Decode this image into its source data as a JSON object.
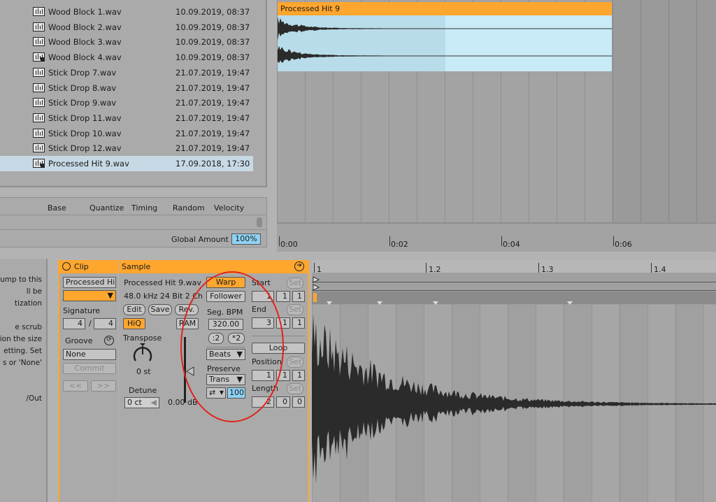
{
  "browser": {
    "files": [
      {
        "name": "Wood Block 1.wav",
        "date": "10.09.2019, 08:37",
        "locked": false
      },
      {
        "name": "Wood Block 2.wav",
        "date": "10.09.2019, 08:37",
        "locked": false
      },
      {
        "name": "Wood Block 3.wav",
        "date": "10.09.2019, 08:37",
        "locked": false
      },
      {
        "name": "Wood Block 4.wav",
        "date": "10.09.2019, 08:37",
        "locked": true
      },
      {
        "name": "Stick Drop 7.wav",
        "date": "21.07.2019, 19:47",
        "locked": false
      },
      {
        "name": "Stick Drop 8.wav",
        "date": "21.07.2019, 19:47",
        "locked": false
      },
      {
        "name": "Stick Drop 9.wav",
        "date": "21.07.2019, 19:47",
        "locked": false
      },
      {
        "name": "Stick Drop 11.wav",
        "date": "21.07.2019, 19:47",
        "locked": false
      },
      {
        "name": "Stick Drop 10.wav",
        "date": "21.07.2019, 19:47",
        "locked": false
      },
      {
        "name": "Stick Drop 12.wav",
        "date": "21.07.2019, 19:47",
        "locked": false
      },
      {
        "name": "Processed Hit 9.wav",
        "date": "17.09.2018, 17:30",
        "locked": true,
        "selected": true
      }
    ],
    "icon": "waveform-file-icon"
  },
  "groove_pool": {
    "headers": [
      "Base",
      "Quantize",
      "Timing",
      "Random",
      "Velocity"
    ],
    "global_amount_label": "Global Amount",
    "global_amount_value": "100%"
  },
  "arrangement": {
    "clip_name": "Processed Hit 9",
    "time_labels": [
      "0:00",
      "0:02",
      "0:04",
      "0:06"
    ]
  },
  "help": {
    "lines": [
      "ump to this",
      "ll be",
      "tization",
      "",
      "e scrub",
      "tion the size",
      "etting. Set",
      "s or 'None'",
      "",
      "",
      "/Out"
    ]
  },
  "clip_panel": {
    "title": "Clip",
    "name_value": "Processed Hi",
    "signature_label": "Signature",
    "sig_num": "4",
    "sig_sep": "/",
    "sig_den": "4",
    "groove_label": "Groove",
    "groove_value": "None",
    "commit_label": "Commit",
    "prev_label": "<<",
    "next_label": ">>"
  },
  "sample_panel": {
    "title": "Sample",
    "file_name": "Processed Hit 9.wav",
    "file_info": "48.0 kHz 24 Bit 2 Ch",
    "edit_label": "Edit",
    "save_label": "Save",
    "rev_label": "Rev.",
    "hiq_label": "HiQ",
    "ram_label": "RAM",
    "transpose_label": "Transpose",
    "transpose_value": "0 st",
    "detune_label": "Detune",
    "detune_value": "0 ct",
    "gain_value": "0.00 dB",
    "warp_label": "Warp",
    "follower_label": "Follower",
    "segbpm_label": "Seg. BPM",
    "segbpm_value": "320.00",
    "half_label": ":2",
    "double_label": "*2",
    "mode_value": "Beats",
    "preserve_label": "Preserve",
    "preserve_value": "Trans",
    "loop_mode_icon": "⇄",
    "loop_amount": "100",
    "start_label": "Start",
    "start_values": [
      "1",
      "1",
      "1"
    ],
    "end_label": "End",
    "end_values": [
      "3",
      "1",
      "1"
    ],
    "loop_label": "Loop",
    "position_label": "Position",
    "position_values": [
      "1",
      "1",
      "1"
    ],
    "length_label": "Length",
    "length_values": [
      "2",
      "0",
      "0"
    ],
    "set_label": "Set"
  },
  "editor": {
    "ruler_labels": [
      "1",
      "1.2",
      "1.3",
      "1.4"
    ]
  },
  "colors": {
    "accent": "#ffa62e",
    "clip_body": "#c9ebf7",
    "selection": "#8fd3f5",
    "annotation": "#e2231a"
  }
}
